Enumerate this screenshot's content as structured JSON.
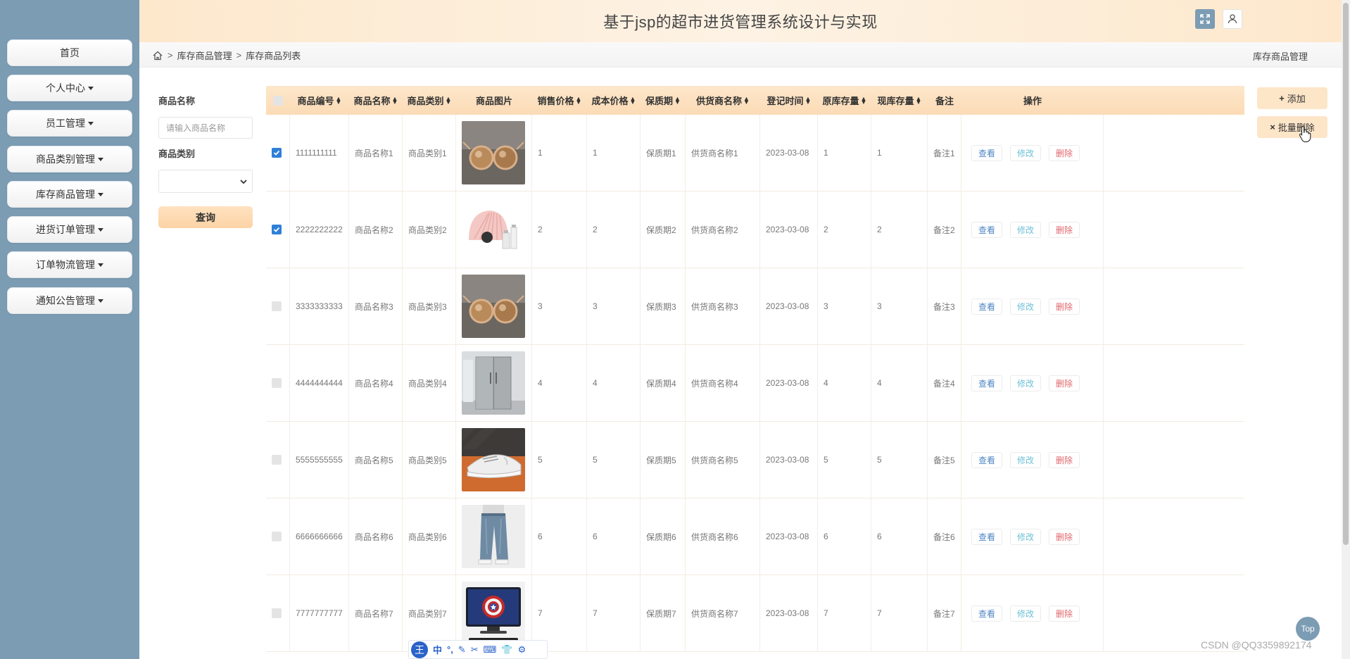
{
  "header": {
    "title": "基于jsp的超市进货管理系统设计与实现"
  },
  "sidebar": {
    "items": [
      {
        "label": "首页",
        "dropdown": false
      },
      {
        "label": "个人中心",
        "dropdown": true
      },
      {
        "label": "员工管理",
        "dropdown": true
      },
      {
        "label": "商品类别管理",
        "dropdown": true
      },
      {
        "label": "库存商品管理",
        "dropdown": true
      },
      {
        "label": "进货订单管理",
        "dropdown": true
      },
      {
        "label": "订单物流管理",
        "dropdown": true
      },
      {
        "label": "通知公告管理",
        "dropdown": true
      }
    ]
  },
  "breadcrumb": {
    "level1": "库存商品管理",
    "level2": "库存商品列表",
    "separator": ">",
    "right_label": "库存商品管理"
  },
  "filter": {
    "name_label": "商品名称",
    "name_placeholder": "请输入商品名称",
    "category_label": "商品类别",
    "category_value": "",
    "query_label": "查询"
  },
  "actions": {
    "add_label": "添加",
    "batch_delete_label": "批量删除"
  },
  "table": {
    "columns": [
      {
        "label": "",
        "sortable": false
      },
      {
        "label": "商品编号",
        "sortable": true
      },
      {
        "label": "商品名称",
        "sortable": true
      },
      {
        "label": "商品类别",
        "sortable": true
      },
      {
        "label": "商品图片",
        "sortable": false
      },
      {
        "label": "销售价格",
        "sortable": true
      },
      {
        "label": "成本价格",
        "sortable": true
      },
      {
        "label": "保质期",
        "sortable": true
      },
      {
        "label": "供货商名称",
        "sortable": true
      },
      {
        "label": "登记时间",
        "sortable": true
      },
      {
        "label": "原库存量",
        "sortable": true
      },
      {
        "label": "现库存量",
        "sortable": true
      },
      {
        "label": "备注",
        "sortable": false
      },
      {
        "label": "操作",
        "sortable": false
      }
    ],
    "op_labels": {
      "view": "查看",
      "edit": "修改",
      "delete": "删除"
    },
    "rows": [
      {
        "checked": true,
        "id": "1111111111",
        "name": "商品名称1",
        "category": "商品类别1",
        "image": "sunglasses",
        "sale_price": "1",
        "cost_price": "1",
        "shelf_life": "保质期1",
        "supplier": "供货商名称1",
        "date": "2023-03-08",
        "orig_stock": "1",
        "cur_stock": "1",
        "remark": "备注1"
      },
      {
        "checked": true,
        "id": "2222222222",
        "name": "商品名称2",
        "category": "商品类别2",
        "image": "cosmetics",
        "sale_price": "2",
        "cost_price": "2",
        "shelf_life": "保质期2",
        "supplier": "供货商名称2",
        "date": "2023-03-08",
        "orig_stock": "2",
        "cur_stock": "2",
        "remark": "备注2"
      },
      {
        "checked": false,
        "id": "3333333333",
        "name": "商品名称3",
        "category": "商品类别3",
        "image": "sunglasses",
        "sale_price": "3",
        "cost_price": "3",
        "shelf_life": "保质期3",
        "supplier": "供货商名称3",
        "date": "2023-03-08",
        "orig_stock": "3",
        "cur_stock": "3",
        "remark": "备注3"
      },
      {
        "checked": false,
        "id": "4444444444",
        "name": "商品名称4",
        "category": "商品类别4",
        "image": "refrigerator",
        "sale_price": "4",
        "cost_price": "4",
        "shelf_life": "保质期4",
        "supplier": "供货商名称4",
        "date": "2023-03-08",
        "orig_stock": "4",
        "cur_stock": "4",
        "remark": "备注4"
      },
      {
        "checked": false,
        "id": "5555555555",
        "name": "商品名称5",
        "category": "商品类别5",
        "image": "sneaker",
        "sale_price": "5",
        "cost_price": "5",
        "shelf_life": "保质期5",
        "supplier": "供货商名称5",
        "date": "2023-03-08",
        "orig_stock": "5",
        "cur_stock": "5",
        "remark": "备注5"
      },
      {
        "checked": false,
        "id": "6666666666",
        "name": "商品名称6",
        "category": "商品类别6",
        "image": "jeans",
        "sale_price": "6",
        "cost_price": "6",
        "shelf_life": "保质期6",
        "supplier": "供货商名称6",
        "date": "2023-03-08",
        "orig_stock": "6",
        "cur_stock": "6",
        "remark": "备注6"
      },
      {
        "checked": false,
        "id": "7777777777",
        "name": "商品名称7",
        "category": "商品类别7",
        "image": "monitor",
        "sale_price": "7",
        "cost_price": "7",
        "shelf_life": "保质期7",
        "supplier": "供货商名称7",
        "date": "2023-03-08",
        "orig_stock": "7",
        "cur_stock": "7",
        "remark": "备注7"
      }
    ]
  },
  "floating": {
    "top_label": "Top",
    "watermark": "CSDN @QQ3359892174",
    "ime_logo": "王",
    "ime_mode": "中"
  },
  "colors": {
    "sidebar": "#7b9cb3",
    "header": "#fde8cc",
    "accent_checkbox": "#2f7fd8",
    "delete": "#e0686e",
    "edit": "#6fc1d6",
    "view": "#4f86c4"
  }
}
